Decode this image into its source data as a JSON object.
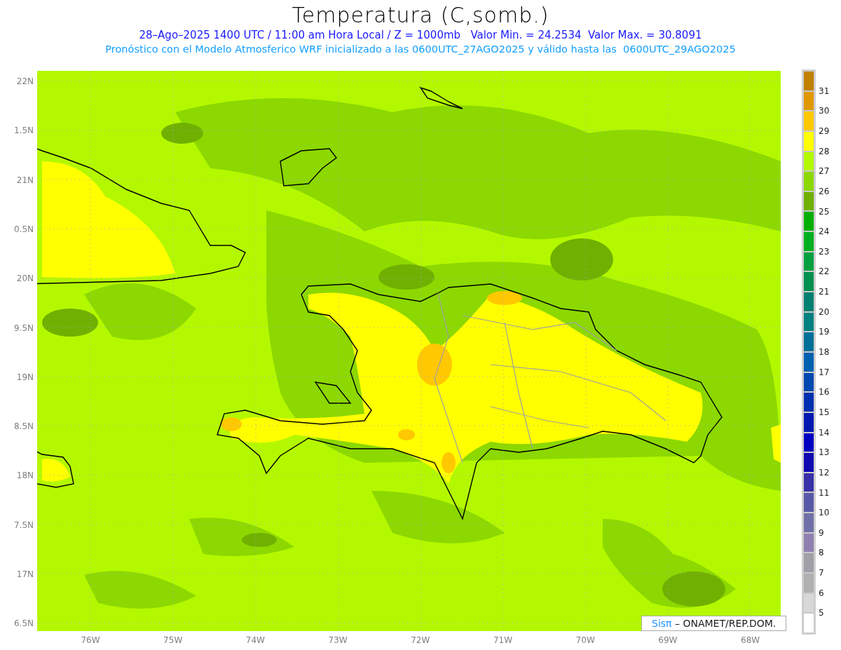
{
  "title": "Temperatura (C,somb.)",
  "subtitle": "28–Ago–2025 1400 UTC / 11:00 am Hora Local / Z = 1000mb   Valor Min. = 24.2534  Valor Max. = 30.8091",
  "model_note": "Pronóstico con el Modelo Atmosferico WRF inicializado a las 0600UTC_27AGO2025 y válido hasta las  0600UTC_29AGO2025",
  "map": {
    "latitude_labels": [
      "22N",
      "1.5N",
      "21N",
      "0.5N",
      "20N",
      "9.5N",
      "19N",
      "8.5N",
      "18N",
      "7.5N",
      "17N",
      "6.5N"
    ],
    "longitude_labels": [
      "76W",
      "75W",
      "74W",
      "73W",
      "72W",
      "71W",
      "70W",
      "69W",
      "68W"
    ],
    "credit": {
      "brand": "Sisπ",
      "text": "– ONAMET/REP.DOM."
    }
  },
  "colorbar": {
    "labels": [
      "31",
      "30",
      "29",
      "28",
      "27",
      "26",
      "25",
      "24",
      "23",
      "22",
      "21",
      "20",
      "19",
      "18",
      "17",
      "16",
      "15",
      "14",
      "13",
      "12",
      "11",
      "10",
      "9",
      "8",
      "7",
      "6",
      "5"
    ],
    "blocks": [
      {
        "color": "#c08000"
      },
      {
        "color": "#e09800"
      },
      {
        "color": "#ffc800"
      },
      {
        "color": "#ffff00"
      },
      {
        "color": "#b4f800"
      },
      {
        "color": "#8cd800"
      },
      {
        "color": "#70b000"
      },
      {
        "color": "#00b000"
      },
      {
        "color": "#00b020"
      },
      {
        "color": "#00a040"
      },
      {
        "color": "#009050"
      },
      {
        "color": "#008070"
      },
      {
        "color": "#008080"
      },
      {
        "color": "#007098"
      },
      {
        "color": "#0060b0"
      },
      {
        "color": "#0048b0"
      },
      {
        "color": "#0030b0"
      },
      {
        "color": "#0018b0"
      },
      {
        "color": "#0000c0"
      },
      {
        "color": "#1008b0"
      },
      {
        "color": "#3830a8"
      },
      {
        "color": "#5858a8"
      },
      {
        "color": "#7070a8"
      },
      {
        "color": "#9080b0"
      },
      {
        "color": "#a0a0a8"
      },
      {
        "color": "#b0b0b0"
      },
      {
        "color": "#d8d8d8"
      },
      {
        "color": "#ffffff"
      }
    ]
  }
}
